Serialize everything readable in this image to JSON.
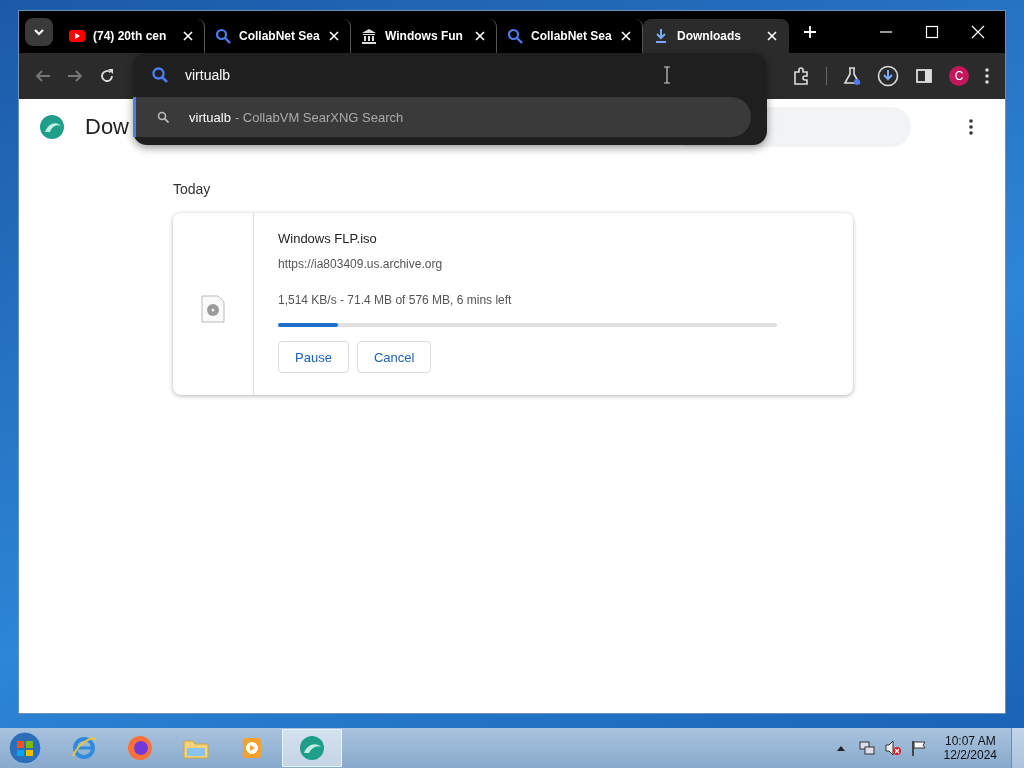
{
  "tabs": [
    {
      "label": "(74) 20th cen",
      "kind": "video",
      "selected": false
    },
    {
      "label": "CollabNet Sea",
      "kind": "search",
      "selected": false
    },
    {
      "label": "Windows Fun",
      "kind": "institution",
      "selected": false
    },
    {
      "label": "CollabNet Sea",
      "kind": "search",
      "selected": false
    },
    {
      "label": "Downloads",
      "kind": "download",
      "selected": true
    }
  ],
  "omnibox": {
    "value": "virtualb",
    "suggestions": [
      {
        "query": "virtualb",
        "source": "- CollabVM SearXNG Search",
        "selected": true
      }
    ]
  },
  "toolbar": {
    "avatar": "C"
  },
  "page": {
    "title": "Dow",
    "section": "Today",
    "downloads": [
      {
        "filename": "Windows FLP.iso",
        "url": "https://ia803409.us.archive.org",
        "status": "1,514 KB/s - 71.4 MB of 576 MB, 6 mins left",
        "level": 0.12,
        "buttons": [
          "Pause",
          "Cancel"
        ]
      }
    ]
  },
  "taskbar": {
    "apps": [
      {
        "kind": "ie",
        "selected": false
      },
      {
        "kind": "firefox",
        "selected": false
      },
      {
        "kind": "folder",
        "selected": false
      },
      {
        "kind": "media",
        "selected": false
      },
      {
        "kind": "browser",
        "selected": true
      }
    ],
    "time": "10:07 AM",
    "date": "12/2/2024"
  }
}
